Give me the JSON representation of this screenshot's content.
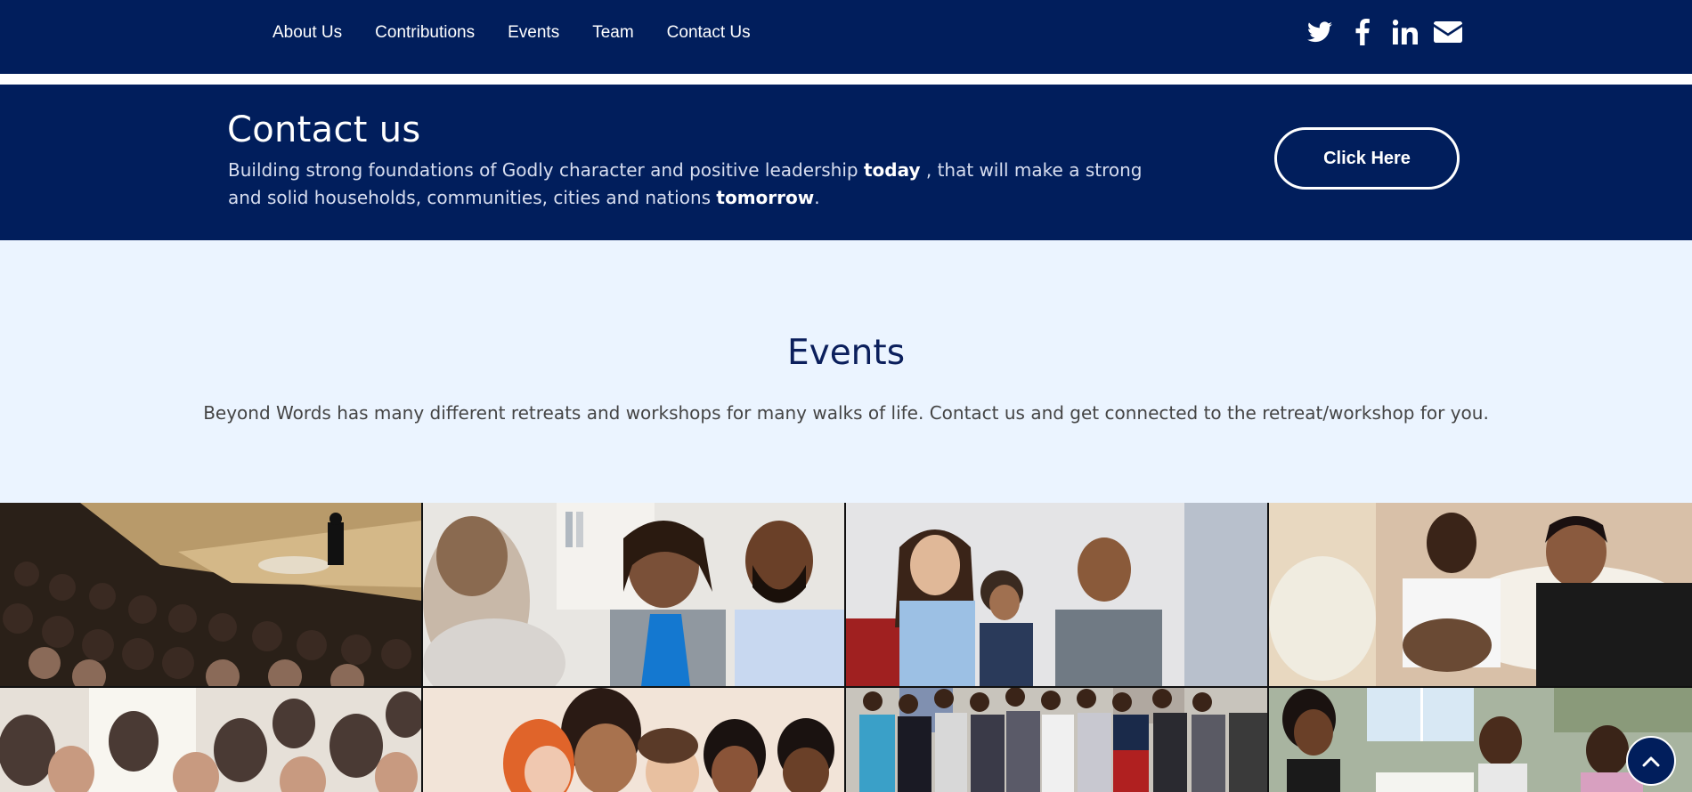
{
  "nav": {
    "links": [
      "About Us",
      "Contributions",
      "Events",
      "Team",
      "Contact Us"
    ],
    "social": [
      "twitter-icon",
      "facebook-icon",
      "linkedin-icon",
      "envelope-icon"
    ]
  },
  "contact": {
    "title": "Contact us",
    "text_before_today": "Building strong foundations of Godly character and positive leadership ",
    "today": "today",
    "text_middle": " , that will make a strong and solid households, communities, cities and nations ",
    "tomorrow": "tomorrow",
    "text_end": ".",
    "button_label": "Click Here"
  },
  "events": {
    "title": "Events",
    "description": "Beyond Words has many different retreats and workshops for many walks of life. Contact us and get connected to the retreat/workshop for you."
  },
  "gallery": {
    "images": [
      "arena-speaker-crowd-photo",
      "women-and-man-conversation-photo",
      "family-on-couch-photo",
      "men-talking-on-sofa-photo",
      "audience-crowd-photo",
      "friends-laughing-photo",
      "youth-group-medals-photo",
      "children-at-table-photo"
    ]
  },
  "colors": {
    "navy": "#011e5c",
    "light_bg": "#ebf4ff",
    "heading": "#0b1f5c"
  },
  "scroll_top_icon": "chevron-up-icon"
}
